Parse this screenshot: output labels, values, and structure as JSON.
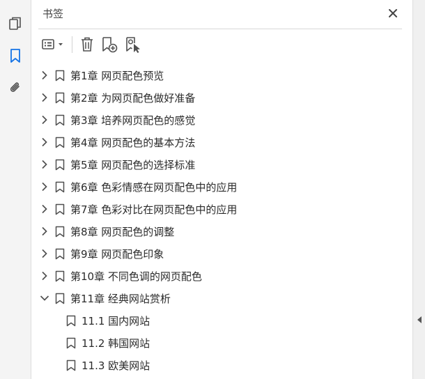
{
  "panel": {
    "title": "书签"
  },
  "rail": {
    "items": [
      {
        "name": "pages-icon"
      },
      {
        "name": "bookmark-icon",
        "active": true
      },
      {
        "name": "attachment-icon"
      }
    ]
  },
  "toolbar": {
    "buttons": [
      "options-menu-icon",
      "delete-icon",
      "new-bookmark-icon",
      "bookmark-from-selection-icon"
    ]
  },
  "bookmarks": [
    {
      "label": "第1章  网页配色预览",
      "expanded": false
    },
    {
      "label": "第2章  为网页配色做好准备",
      "expanded": false
    },
    {
      "label": "第3章  培养网页配色的感觉",
      "expanded": false
    },
    {
      "label": "第4章  网页配色的基本方法",
      "expanded": false
    },
    {
      "label": "第5章  网页配色的选择标准",
      "expanded": false
    },
    {
      "label": "第6章  色彩情感在网页配色中的应用",
      "expanded": false
    },
    {
      "label": "第7章  色彩对比在网页配色中的应用",
      "expanded": false
    },
    {
      "label": "第8章  网页配色的调整",
      "expanded": false
    },
    {
      "label": "第9章  网页配色印象",
      "expanded": false
    },
    {
      "label": "第10章  不同色调的网页配色",
      "expanded": false
    },
    {
      "label": "第11章  经典网站赏析",
      "expanded": true
    },
    {
      "label": "11.1  国内网站",
      "child": true
    },
    {
      "label": "11.2  韩国网站",
      "child": true
    },
    {
      "label": "11.3  欧美网站",
      "child": true
    }
  ],
  "colors": {
    "accent": "#1473e6",
    "icon": "#505050"
  }
}
